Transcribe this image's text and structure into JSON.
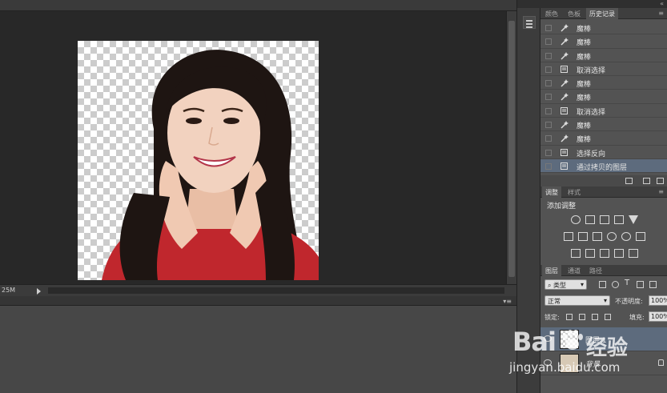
{
  "status_bar": {
    "doc_size_fragment": "25M"
  },
  "history_panel": {
    "tabs": [
      "颜色",
      "色板",
      "历史记录"
    ],
    "active_tab": "历史记录",
    "rows": [
      {
        "label": "魔棒",
        "icon": "magic-wand-icon"
      },
      {
        "label": "魔棒",
        "icon": "magic-wand-icon"
      },
      {
        "label": "魔棒",
        "icon": "magic-wand-icon"
      },
      {
        "label": "取消选择",
        "icon": "document-icon"
      },
      {
        "label": "魔棒",
        "icon": "magic-wand-icon"
      },
      {
        "label": "魔棒",
        "icon": "magic-wand-icon"
      },
      {
        "label": "取消选择",
        "icon": "document-icon"
      },
      {
        "label": "魔棒",
        "icon": "magic-wand-icon"
      },
      {
        "label": "魔棒",
        "icon": "magic-wand-icon"
      },
      {
        "label": "选择反向",
        "icon": "document-icon"
      },
      {
        "label": "通过拷贝的图层",
        "icon": "document-icon"
      }
    ],
    "selected_index": 10
  },
  "adjustments_panel": {
    "tabs": [
      "调整",
      "样式"
    ],
    "active_tab": "调整",
    "title": "添加调整"
  },
  "layers_panel": {
    "tabs": [
      "图层",
      "通道",
      "路径"
    ],
    "active_tab": "图层",
    "kind_filter": "类型",
    "blend_mode": "正常",
    "opacity_label": "不透明度:",
    "opacity_value": "100%",
    "lock_label": "锁定:",
    "fill_label": "填充:",
    "fill_value": "100%",
    "layers": [
      {
        "name": "图层 1",
        "selected": true
      },
      {
        "name": "背景",
        "selected": false,
        "locked": true
      }
    ]
  },
  "watermark": {
    "brand": "Bai",
    "brand_suffix": "经验",
    "url": "jingyan.baidu.com"
  },
  "colors": {
    "workspace": "#282828",
    "panel": "#535353",
    "selection": "#5d6b7d"
  }
}
